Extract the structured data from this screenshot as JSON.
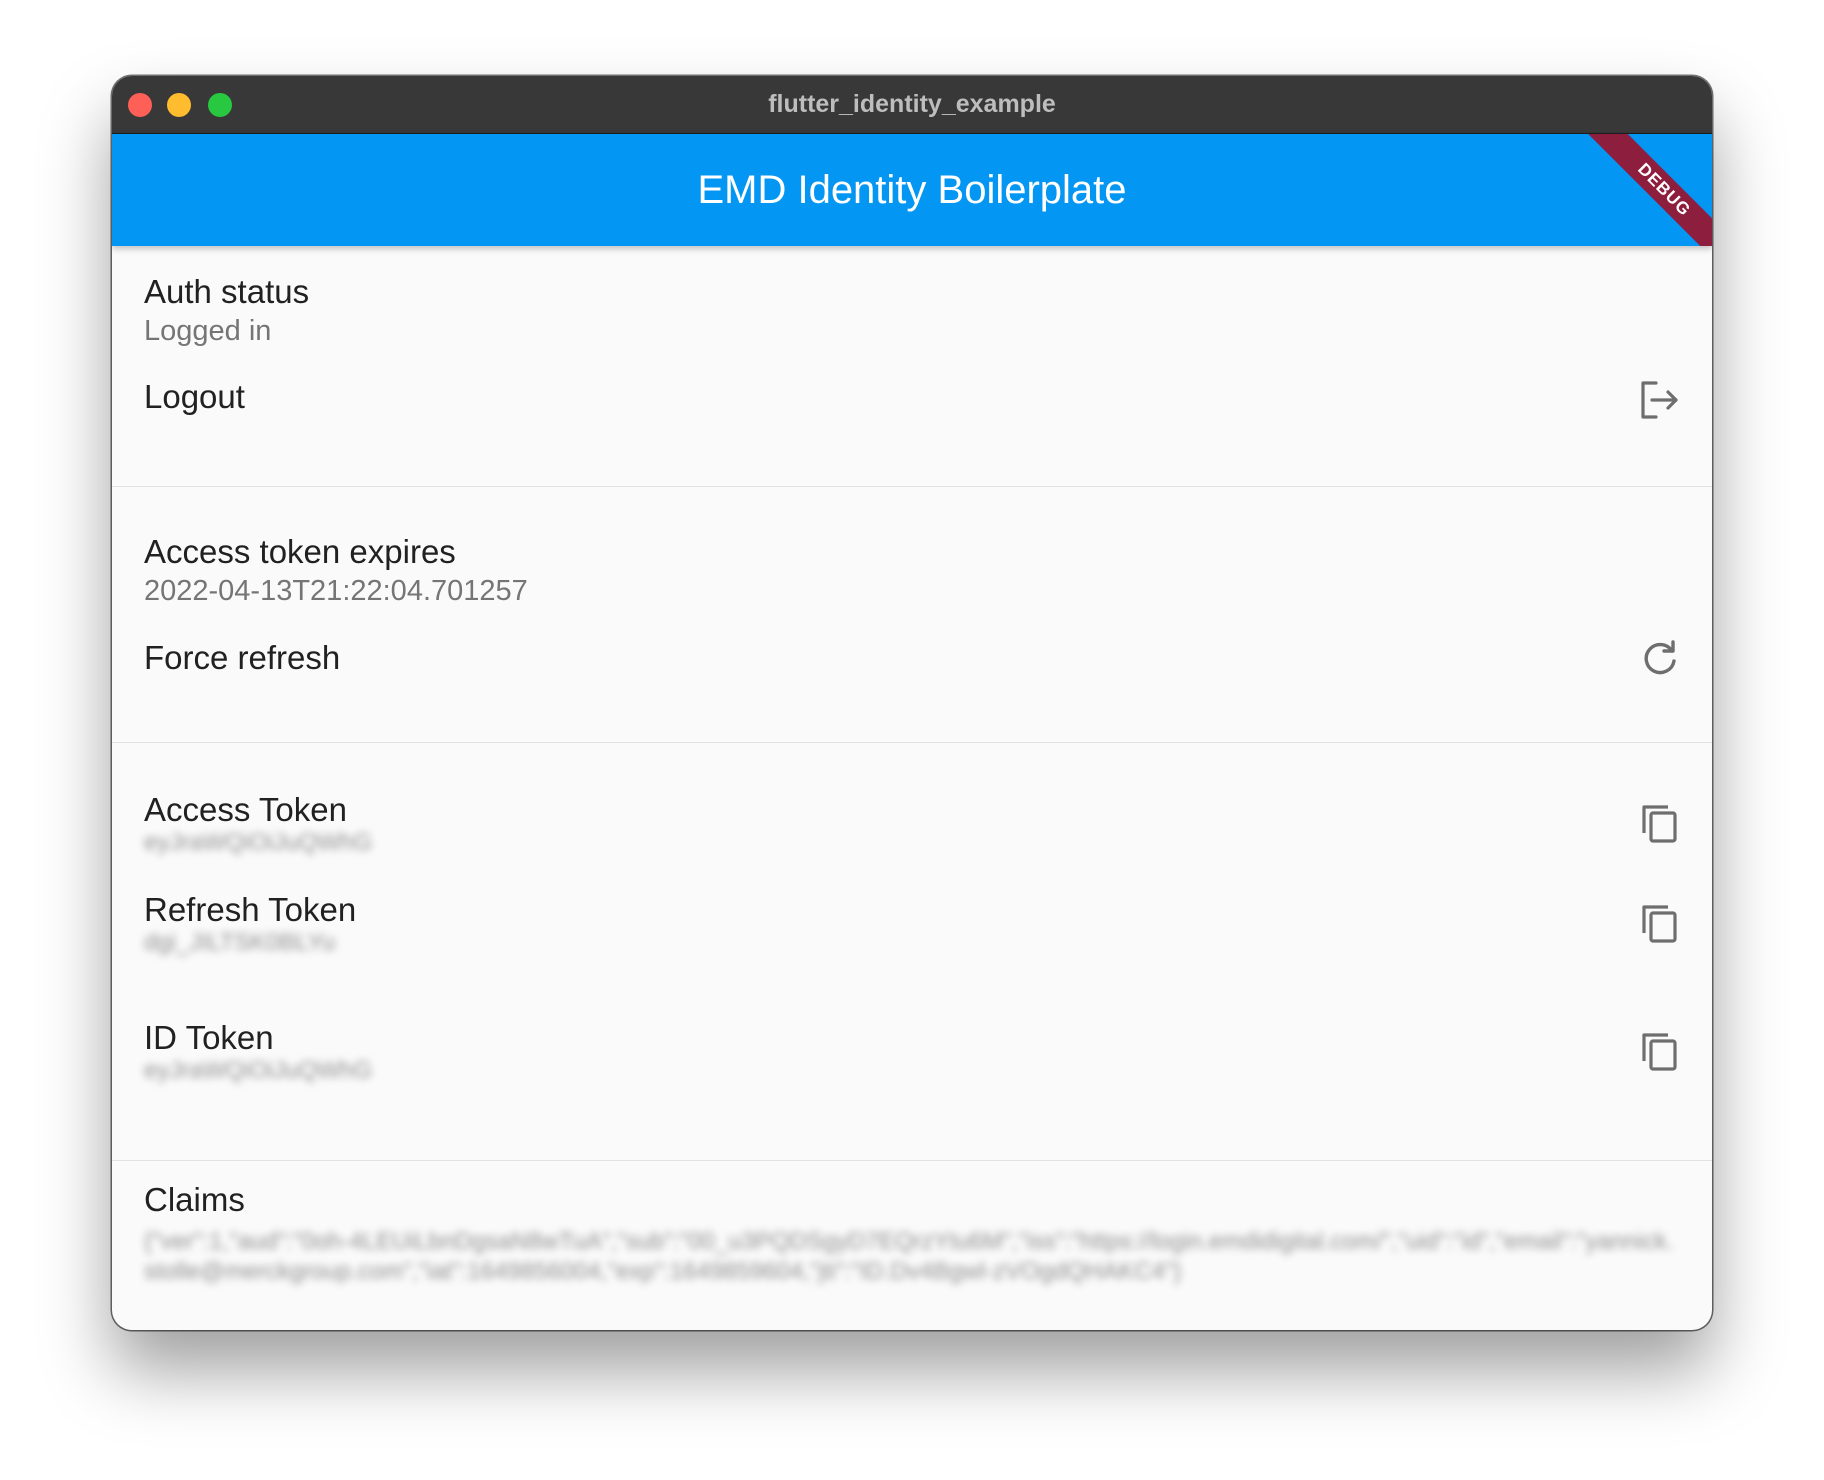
{
  "window": {
    "title": "flutter_identity_example"
  },
  "appbar": {
    "title": "EMD Identity Boilerplate",
    "debug_label": "DEBUG"
  },
  "auth": {
    "status_title": "Auth status",
    "status_value": "Logged in",
    "logout_label": "Logout",
    "logout_icon": "logout-icon"
  },
  "token_expiry": {
    "title": "Access token expires",
    "value": "2022-04-13T21:22:04.701257",
    "force_refresh_label": "Force refresh",
    "refresh_icon": "refresh-icon"
  },
  "tokens": [
    {
      "title": "Access Token",
      "value": "eyJraWQiOiJuQWhG",
      "copy_icon": "copy-icon"
    },
    {
      "title": "Refresh Token",
      "value": "dgi_JILTSK0BLYu",
      "copy_icon": "copy-icon"
    },
    {
      "title": "ID Token",
      "value": "eyJraWQiOiJuQWhG",
      "copy_icon": "copy-icon"
    }
  ],
  "claims": {
    "title": "Claims",
    "value": "{\"ver\":1,\"aud\":\"0oh-4LEUiLbnDgsaN8wTuA\",\"sub\":\"00_u3PQDSgyD7EQrzYtu6M\",\"iss\":\"https://login.emdidigital.com/\",\"uid\":\"id\",\"email\":\"yannick.stolle@merckgroup.com\",\"iat\":1649856004,\"exp\":1649859604,\"jti\":\"ID.Dv4Bgwl-zVOgdQHAKC4\"}"
  },
  "colors": {
    "appbar": "#0396f3",
    "titlebar": "#383838",
    "debug_banner": "#8e1e3e",
    "background": "#fafafa"
  }
}
